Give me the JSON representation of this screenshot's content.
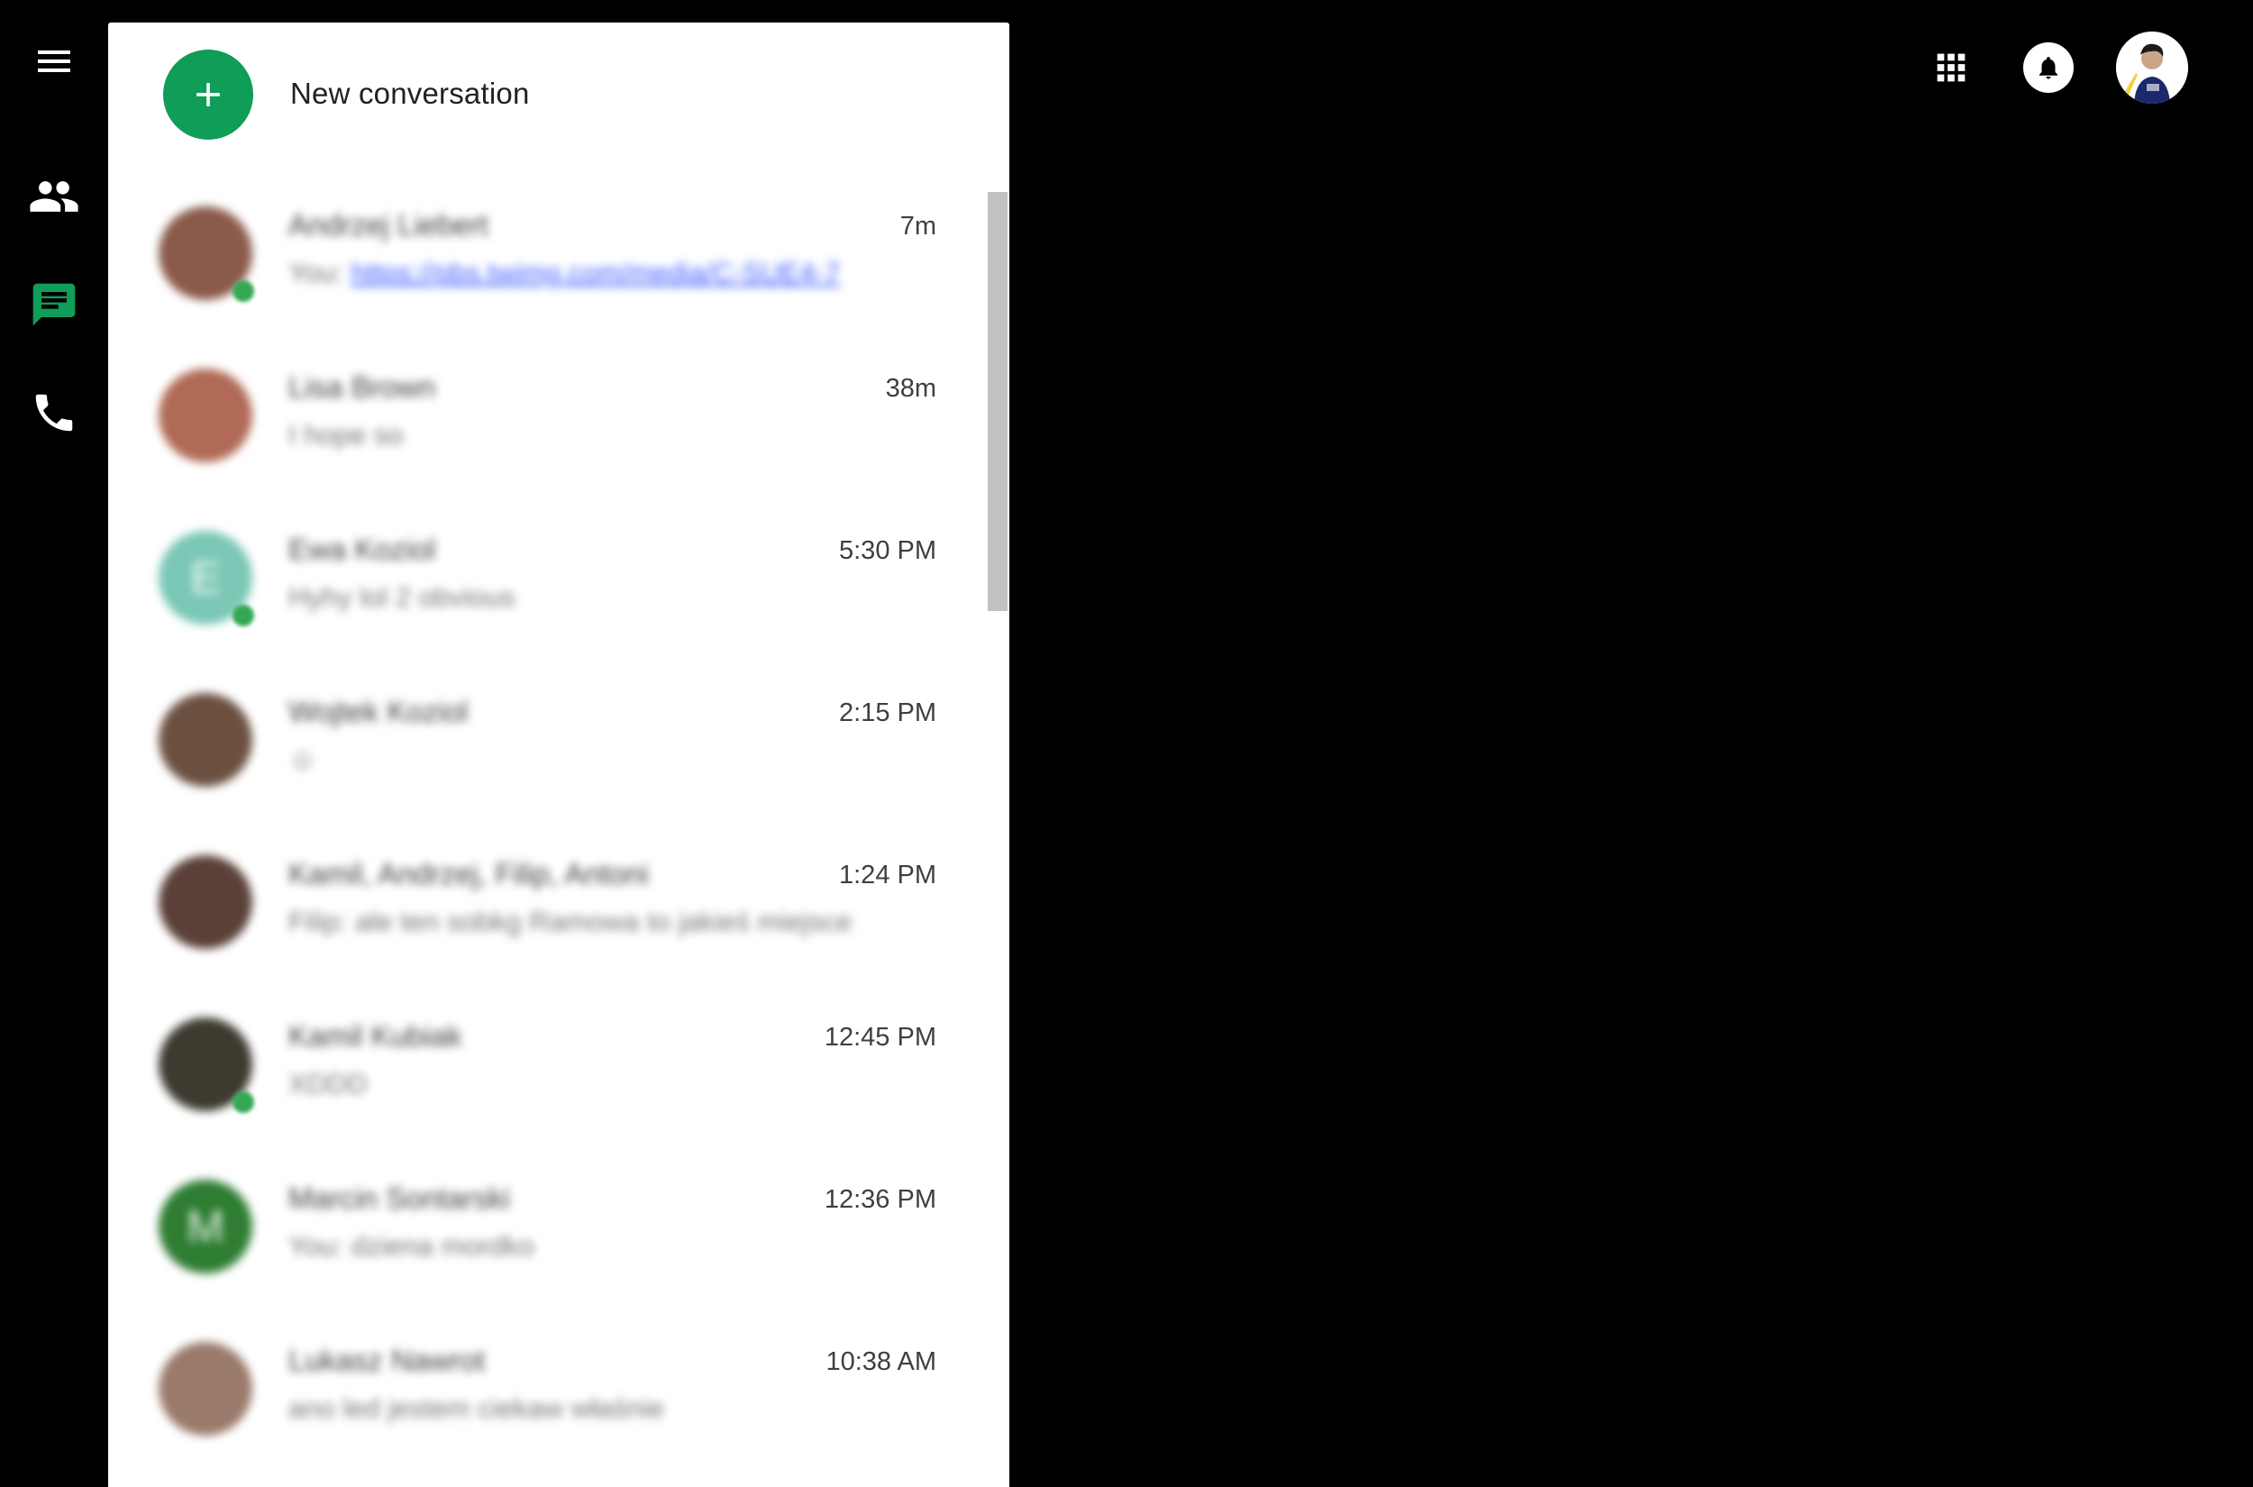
{
  "app": {
    "accent_color": "#0f9d58",
    "background_color": "#000000"
  },
  "rail": {
    "items": [
      {
        "icon": "menu-icon",
        "active": false
      },
      {
        "icon": "contacts-icon",
        "active": false
      },
      {
        "icon": "chat-icon",
        "active": true
      },
      {
        "icon": "phone-icon",
        "active": false
      }
    ]
  },
  "panel": {
    "new_conversation_label": "New conversation",
    "conversations": [
      {
        "name": "Andrzej Liebert",
        "snippet_prefix": "You: ",
        "snippet_link": "https://pbs.twimg.com/media/C-SUE4-7",
        "snippet": "",
        "time": "7m",
        "avatar_color": "#8a5a4a",
        "online": true
      },
      {
        "name": "Lisa Brown",
        "snippet_prefix": "",
        "snippet_link": "",
        "snippet": "I hope so",
        "time": "38m",
        "avatar_color": "#b06a55",
        "online": false
      },
      {
        "name": "Ewa Koziol",
        "snippet_prefix": "",
        "snippet_link": "",
        "snippet": "Hyhy lol 2 obvious",
        "time": "5:30 PM",
        "avatar_color": "#7ac7b5",
        "avatar_letter": "E",
        "online": true
      },
      {
        "name": "Wojtek Koziol",
        "snippet_prefix": "",
        "snippet_link": "",
        "snippet": "☺",
        "time": "2:15 PM",
        "avatar_color": "#6b5040",
        "online": false
      },
      {
        "name": "Kamil, Andrzej, Filip, Antoni",
        "snippet_prefix": "",
        "snippet_link": "",
        "snippet": "Filip: ale ten sobkg Ramowa to jakieś miejsce",
        "time": "1:24 PM",
        "avatar_color": "#5a4038",
        "online": false
      },
      {
        "name": "Kamil Kubiak",
        "snippet_prefix": "",
        "snippet_link": "",
        "snippet": "XDDD",
        "time": "12:45 PM",
        "avatar_color": "#3d3a30",
        "online": true
      },
      {
        "name": "Marcin Sontarski",
        "snippet_prefix": "",
        "snippet_link": "",
        "snippet": "You: dziena mordko",
        "time": "12:36 PM",
        "avatar_color": "#2e7d32",
        "avatar_letter": "M",
        "online": false
      },
      {
        "name": "Lukasz Nawrot",
        "snippet_prefix": "",
        "snippet_link": "",
        "snippet": "ano led jestem ciekaw właśnie",
        "time": "10:38 AM",
        "avatar_color": "#9a7a6a",
        "online": false
      }
    ]
  },
  "topbar": {
    "apps_icon": "apps-grid-icon",
    "notifications_icon": "bell-icon",
    "profile_icon": "profile-avatar"
  }
}
